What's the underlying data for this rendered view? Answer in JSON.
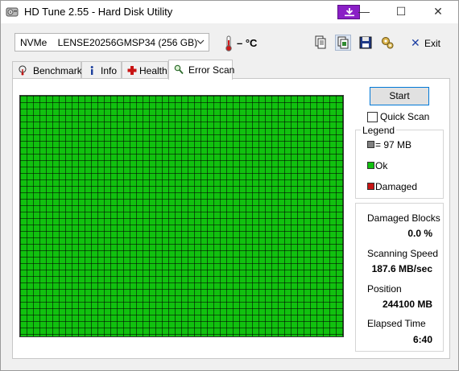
{
  "window": {
    "title": "HD Tune 2.55 - Hard Disk Utility",
    "controls": {
      "minimize": "—",
      "maximize": "☐",
      "close": "✕"
    }
  },
  "toolbar": {
    "drive_label": "NVMe    LENSE20256GMSP34 (256 GB)",
    "temperature": "– °C",
    "exit_label": "Exit",
    "icons": [
      "copy-icon",
      "copy-info-icon",
      "save-icon",
      "options-icon"
    ]
  },
  "tabs": [
    {
      "label": "Benchmark",
      "icon": "benchmark-icon",
      "active": false
    },
    {
      "label": "Info",
      "icon": "info-icon",
      "active": false
    },
    {
      "label": "Health",
      "icon": "health-icon",
      "active": false
    },
    {
      "label": "Error Scan",
      "icon": "search-icon",
      "active": true
    }
  ],
  "scan": {
    "start_label": "Start",
    "quick_scan_label": "Quick Scan",
    "quick_scan_checked": false,
    "block_status": "all ok",
    "ok_color": "#11c10f"
  },
  "legend": {
    "title": "Legend",
    "items": [
      {
        "label": "= 97 MB",
        "color": "#808080"
      },
      {
        "label": "Ok",
        "color": "#11c10f"
      },
      {
        "label": "Damaged",
        "color": "#c81414"
      }
    ]
  },
  "stats": {
    "damaged_blocks_label": "Damaged Blocks",
    "damaged_blocks_value": "0.0 %",
    "scanning_speed_label": "Scanning Speed",
    "scanning_speed_value": "187.6 MB/sec",
    "position_label": "Position",
    "position_value": "244100 MB",
    "elapsed_time_label": "Elapsed Time",
    "elapsed_time_value": "6:40"
  }
}
